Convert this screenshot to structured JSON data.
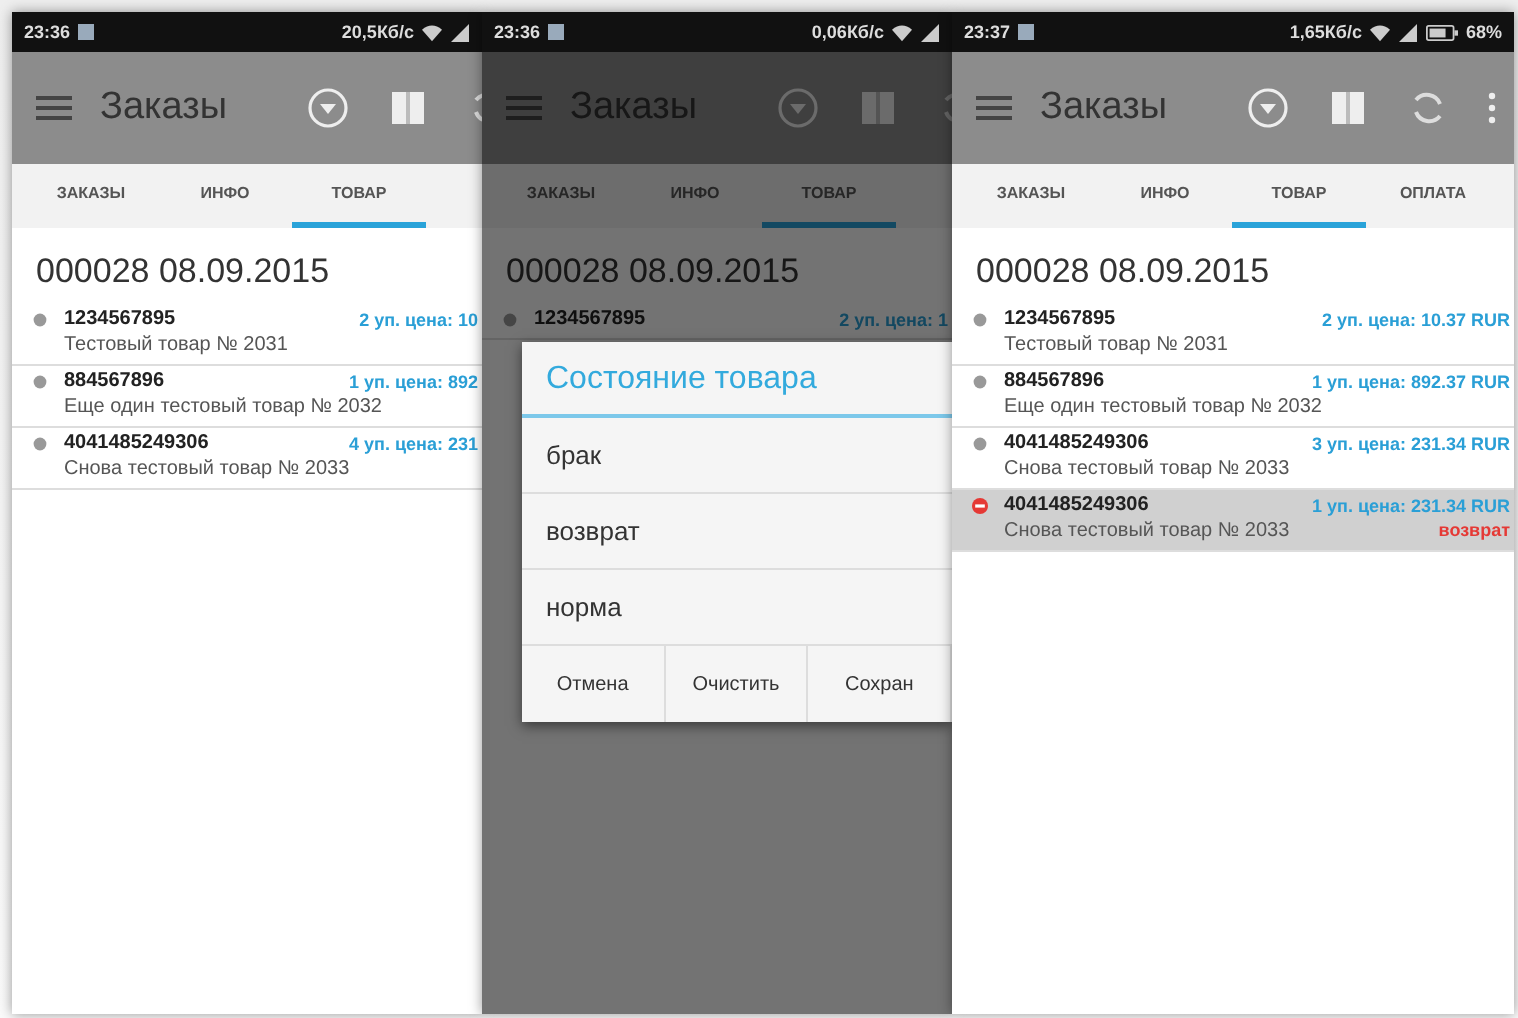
{
  "phones": [
    {
      "status": {
        "time": "23:36",
        "speed": "20,5Кб/с"
      },
      "toolbar": {
        "title": "Заказы"
      },
      "dimmed": false,
      "tabs": [
        {
          "label": "ЗАКАЗЫ",
          "selected": false
        },
        {
          "label": "ИНФО",
          "selected": false
        },
        {
          "label": "ТОВАР",
          "selected": true
        }
      ],
      "order_header": "000028 08.09.2015",
      "items": [
        {
          "code": "1234567895",
          "price": "2 уп. цена: 10",
          "name": "Тестовый товар № 2031",
          "selected": false,
          "flagged": false
        },
        {
          "code": "884567896",
          "price": "1 уп. цена: 892",
          "name": "Еще один тестовый товар № 2032",
          "selected": false,
          "flagged": false
        },
        {
          "code": "4041485249306",
          "price": "4 уп. цена: 231",
          "name": "Снова тестовый товар № 2033",
          "selected": false,
          "flagged": false
        }
      ]
    },
    {
      "status": {
        "time": "23:36",
        "speed": "0,06Кб/с"
      },
      "toolbar": {
        "title": "Заказы"
      },
      "dimmed": true,
      "tabs": [
        {
          "label": "ЗАКАЗЫ",
          "selected": false
        },
        {
          "label": "ИНФО",
          "selected": false
        },
        {
          "label": "ТОВАР",
          "selected": true
        }
      ],
      "order_header": "000028 08.09.2015",
      "items": [
        {
          "code": "1234567895",
          "price": "2 уп. цена: 1",
          "selected": false,
          "flagged": false
        }
      ],
      "dialog": {
        "title": "Состояние товара",
        "options": [
          "брак",
          "возврат",
          "норма"
        ],
        "buttons": [
          "Отмена",
          "Очистить",
          "Сохран"
        ]
      }
    },
    {
      "status": {
        "time": "23:37",
        "speed": "1,65Кб/с",
        "battery": "68%"
      },
      "toolbar": {
        "title": "Заказы"
      },
      "dimmed": false,
      "tabs": [
        {
          "label": "ЗАКАЗЫ",
          "selected": false
        },
        {
          "label": "ИНФО",
          "selected": false
        },
        {
          "label": "ТОВАР",
          "selected": true
        },
        {
          "label": "ОПЛАТА",
          "selected": false
        }
      ],
      "order_header": "000028 08.09.2015",
      "items": [
        {
          "code": "1234567895",
          "price": "2 уп. цена: 10.37 RUR",
          "name": "Тестовый товар № 2031",
          "selected": false,
          "flagged": false
        },
        {
          "code": "884567896",
          "price": "1 уп. цена: 892.37 RUR",
          "name": "Еще один тестовый товар № 2032",
          "selected": false,
          "flagged": false
        },
        {
          "code": "4041485249306",
          "price": "3 уп. цена: 231.34 RUR",
          "name": "Снова тестовый товар № 2033",
          "selected": false,
          "flagged": false
        },
        {
          "code": "4041485249306",
          "price": "1 уп. цена: 231.34 RUR",
          "name": "Снова тестовый товар № 2033",
          "state": "возврат",
          "selected": true,
          "flagged": true
        }
      ]
    }
  ]
}
